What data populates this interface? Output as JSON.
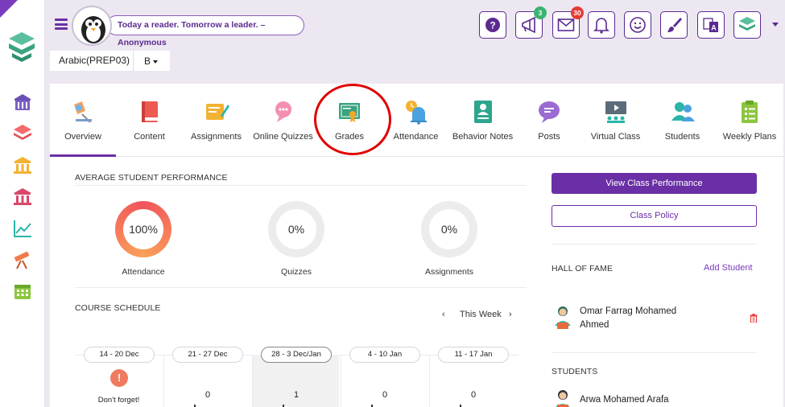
{
  "header": {
    "quote": "Today a reader. Tomorrow a leader. – Anonymous",
    "announcements_badge": "3",
    "messages_badge": "30"
  },
  "breadcrumb": {
    "subject": "Arabic(PREP03)",
    "section": "B"
  },
  "tabs": [
    {
      "label": "Overview",
      "icon": "overview-icon"
    },
    {
      "label": "Content",
      "icon": "book-icon"
    },
    {
      "label": "Assignments",
      "icon": "assignment-icon"
    },
    {
      "label": "Online Quizzes",
      "icon": "quiz-chat-icon"
    },
    {
      "label": "Grades",
      "icon": "certificate-icon"
    },
    {
      "label": "Attendance",
      "icon": "bell-clock-icon"
    },
    {
      "label": "Behavior Notes",
      "icon": "person-note-icon"
    },
    {
      "label": "Posts",
      "icon": "chat-bubble-icon"
    },
    {
      "label": "Virtual Class",
      "icon": "virtual-class-icon"
    },
    {
      "label": "Students",
      "icon": "students-icon"
    },
    {
      "label": "Weekly Plans",
      "icon": "clipboard-icon"
    }
  ],
  "performance": {
    "title": "AVERAGE STUDENT PERFORMANCE",
    "metrics": [
      {
        "label": "Attendance",
        "value": "100%",
        "fraction": 1.0
      },
      {
        "label": "Quizzes",
        "value": "0%",
        "fraction": 0.0
      },
      {
        "label": "Assignments",
        "value": "0%",
        "fraction": 0.0
      }
    ]
  },
  "schedule": {
    "title": "COURSE SCHEDULE",
    "week_label": "This Week",
    "weeks": [
      {
        "range": "14 - 20 Dec",
        "note": "Don't forget!"
      },
      {
        "range": "21 - 27 Dec",
        "count": "0"
      },
      {
        "range": "28 - 3 Dec/Jan",
        "count": "1"
      },
      {
        "range": "4 - 10 Jan",
        "count": "0"
      },
      {
        "range": "11 - 17 Jan",
        "count": "0"
      }
    ]
  },
  "side": {
    "view_performance": "View Class Performance",
    "class_policy": "Class Policy",
    "hall_of_fame_title": "HALL OF FAME",
    "add_student": "Add Student",
    "hall_of_fame": [
      {
        "name_line1": "Omar Farrag Mohamed",
        "name_line2": "Ahmed"
      }
    ],
    "students_title": "STUDENTS",
    "students": [
      {
        "name": "Arwa Mohamed Arafa"
      }
    ]
  },
  "colors": {
    "primary": "#6a2fa5",
    "attendance_ring_start": "#f9a05a",
    "attendance_ring_end": "#f2545b",
    "annotation": "#e00000"
  }
}
